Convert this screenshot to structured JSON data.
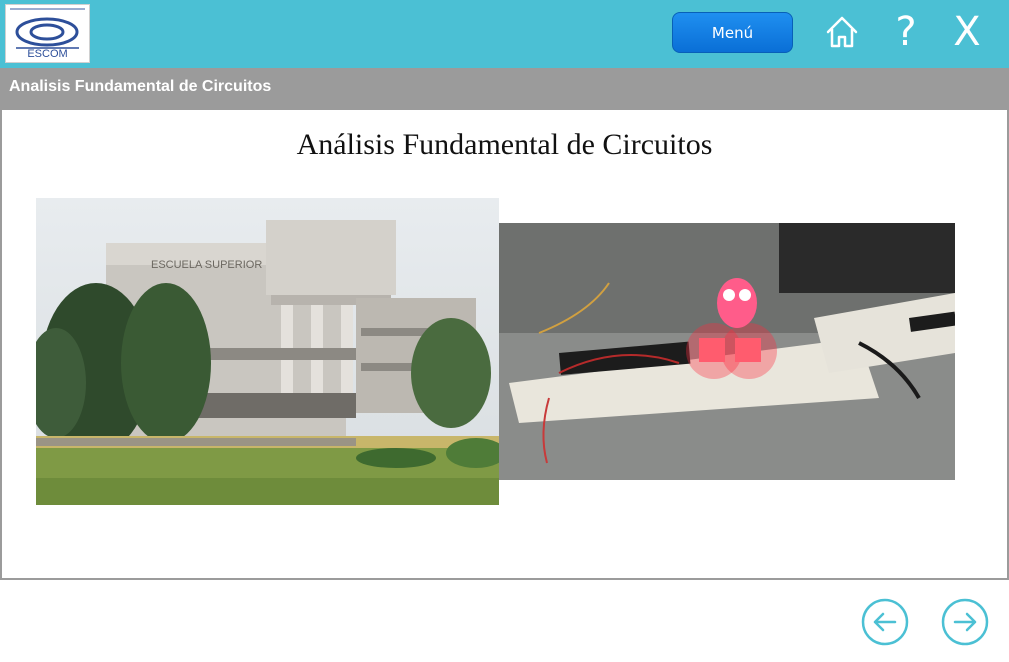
{
  "header": {
    "logo_text": "ESCOM",
    "menu_label": "Menú",
    "help_label": "?",
    "close_label": "X"
  },
  "titlebar": {
    "title": "Analisis Fundamental de Circuitos"
  },
  "main": {
    "heading": "Análisis Fundamental de Circuitos",
    "building_sign": "ESCUELA SUPERIOR DE CÓMPUTO"
  },
  "colors": {
    "topbar": "#4bc0d4",
    "titlebar": "#9b9b9b",
    "menu_button": "#1f8ff0",
    "nav_arrow": "#4bc0d4"
  }
}
